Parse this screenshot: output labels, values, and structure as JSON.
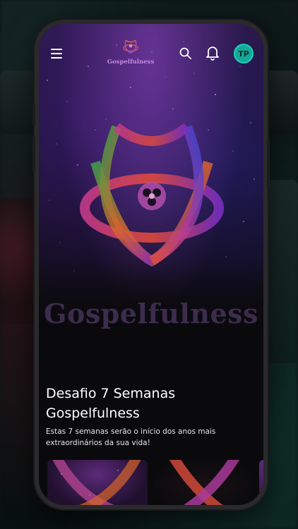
{
  "app": {
    "logo_text": "Gospelfulness",
    "hero_title": "Gospelfulness"
  },
  "topbar": {
    "icons": [
      "menu-icon",
      "search-icon",
      "bell-icon"
    ],
    "avatar_initials": "TP",
    "avatar_color": "#13a898"
  },
  "content": {
    "title": "Desafio 7 Semanas Gospelfulness",
    "description": "Estas 7 semanas serão o início dos anos mais extraordinários da sua vida!"
  },
  "colors": {
    "accent": "#c58ae0",
    "background": "#0a0a0c"
  }
}
